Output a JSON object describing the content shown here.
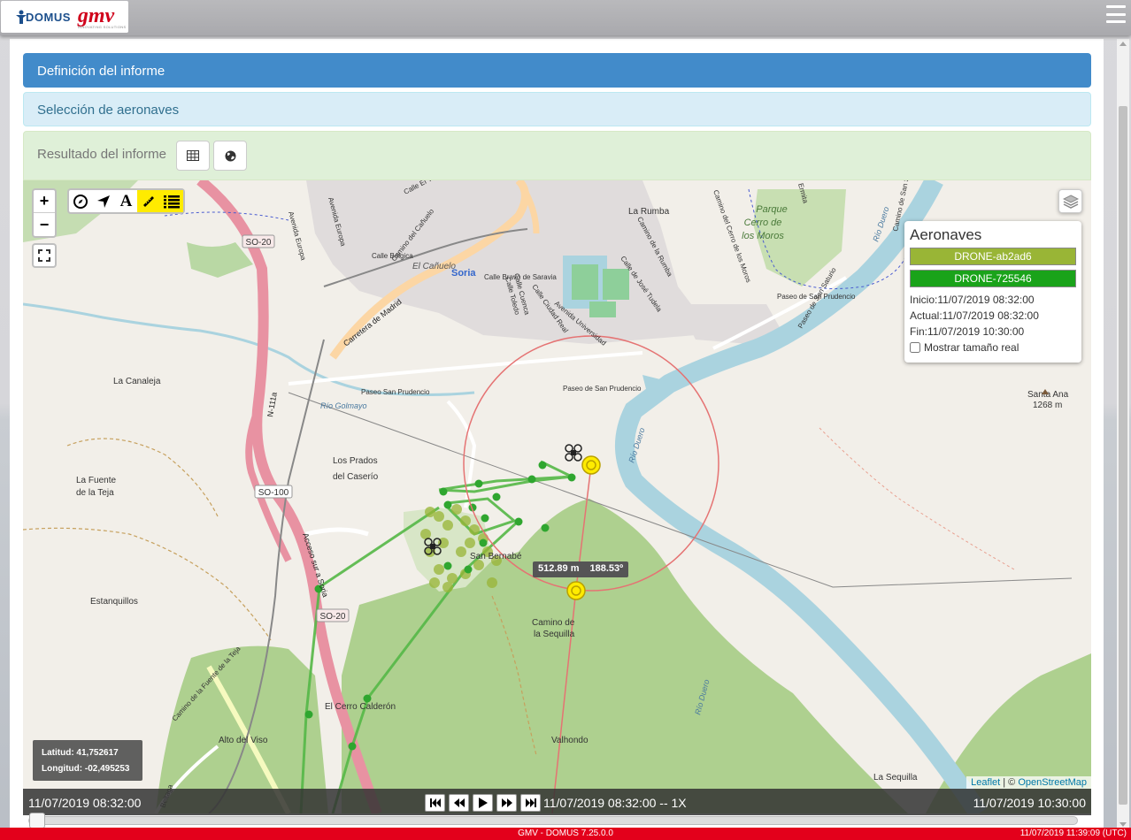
{
  "logo": {
    "domus": "DOMUS",
    "gmv": "gmv",
    "gmv_sub": "INNOVATING SOLUTIONS"
  },
  "accordion": {
    "definition": "Definición del informe",
    "selection": "Selección de aeronaves",
    "result": "Resultado del informe"
  },
  "map": {
    "labels": {
      "la_rumba": "La Rumba",
      "parque": "Parque",
      "cerro_de": "Cerro de",
      "los_moros": "los Moros",
      "calle_el_viso": "Calle El Viso",
      "avenida_europa": "Avenida Europa",
      "calle_belgica": "Calle Bélgica",
      "camino_canuelo": "Camino del Cañuelo",
      "el_canuelo": "El Cañuelo",
      "soria": "Soria",
      "calle_bravo": "Calle Bravo de Saravia",
      "carretera_madrid": "Carretera de Madrid",
      "calle_toledo": "Calle Toledo",
      "calle_cuenca": "Calle Cuenca",
      "calle_ciudad_real": "Calle Ciudad Real",
      "avenida_universidad": "Avenida Universidad",
      "calle_jose_tudela": "Calle de José Tudela",
      "camino_rumba": "Camino de la Rumba",
      "camino_cerro": "Camino del Cerro de los Moros",
      "paseo_san_prudencio_1": "Paseo de San Prudencio",
      "paseo_san_prudencio_2": "Paseo San Prudencio",
      "paseo_san_prudencio_3": "Paseo de San Prudencio",
      "rio_duero": "Río Duero",
      "rio_golmayo": "Río Golmayo",
      "la_canaleja": "La Canaleja",
      "n111a": "N-111a",
      "so20_top": "SO-20",
      "so20_bottom": "SO-20",
      "so100": "SO-100",
      "santa_ana": "Santa Ana",
      "santa_ana_alt": "1268 m",
      "los_prados": "Los Prados",
      "del_caserio": "del Caserío",
      "la_fuente": "La Fuente",
      "de_la_teja": "de la Teja",
      "san_bernabe": "San Bernabé",
      "estanquillos": "Estanquillos",
      "acceso_sur": "Acceso sur a Soria",
      "camino_sequilla": "Camino de",
      "camino_sequilla2": "la Sequilla",
      "el_cerro_calderon": "El Cerro Calderón",
      "alto_del_viso": "Alto del Viso",
      "valhondo": "Valhondo",
      "la_sequilla": "La Sequilla",
      "camino_fuente_teja": "Camino de la Fuente de la Teja",
      "ermita": "Ermita",
      "camino_san_saturio": "Camino de San Saturio",
      "beltaga": "Beltaga",
      "paseo_san_saturio": "Paseo de San Saturio"
    },
    "distance": "512.89 m",
    "bearing": "188.53º",
    "coords": {
      "lat": "Latitud: 41,752617",
      "lon": "Longitud: -02,495253"
    },
    "attribution": {
      "leaflet": "Leaflet",
      "sep": " | © ",
      "osm": "OpenStreetMap"
    }
  },
  "toolbar": {
    "zoom_in": "+",
    "zoom_out": "−",
    "text_tool": "A"
  },
  "aeronaves": {
    "title": "Aeronaves",
    "drones": [
      {
        "label": "DRONE-ab2ad6",
        "color": "#99b536"
      },
      {
        "label": "DRONE-725546",
        "color": "#1aa31a"
      }
    ],
    "inicio": "Inicio:11/07/2019 08:32:00",
    "actual": "Actual:11/07/2019 08:32:00",
    "fin": "Fin:11/07/2019 10:30:00",
    "real_size": "Mostrar tamaño real"
  },
  "playback": {
    "start": "11/07/2019 08:32:00",
    "current": "11/07/2019 08:32:00 -- 1X",
    "end": "11/07/2019 10:30:00",
    "progress": 0
  },
  "footer": {
    "version": "GMV - DOMUS 7.25.0.0",
    "time": "11/07/2019 11:39:09 (UTC)"
  },
  "colors": {
    "accent_blue": "#428bca",
    "drone1": "#99b536",
    "drone2": "#1aa31a",
    "footer_red": "#e3001b"
  }
}
